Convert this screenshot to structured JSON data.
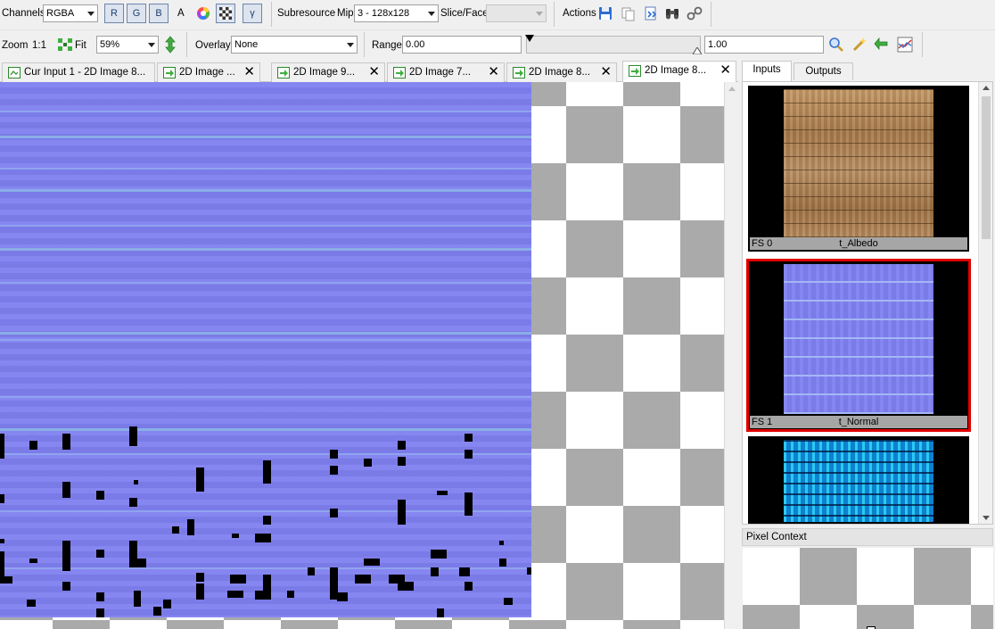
{
  "toolbar1": {
    "channels_label": "Channels",
    "channels_value": "RGBA",
    "r": "R",
    "g": "G",
    "b": "B",
    "a": "A",
    "gamma": "γ",
    "subresource_label": "Subresource",
    "mip_label": "Mip",
    "mip_value": "3 - 128x128",
    "slice_label": "Slice/Face",
    "slice_value": "",
    "actions_label": "Actions"
  },
  "toolbar2": {
    "zoom_label": "Zoom",
    "zoom_1to1": "1:1",
    "fit_label": "Fit",
    "zoom_value": "59%",
    "overlay_label": "Overlay",
    "overlay_value": "None",
    "range_label": "Range",
    "range_min": "0.00",
    "range_max": "1.00"
  },
  "tabs": [
    {
      "label": "Cur Input 1 - 2D Image 8..."
    },
    {
      "label": "2D Image ..."
    },
    {
      "label": "2D Image 9..."
    },
    {
      "label": "2D Image 7..."
    },
    {
      "label": "2D Image 8..."
    },
    {
      "label": "2D Image 8..."
    }
  ],
  "panel": {
    "tab_inputs": "Inputs",
    "tab_outputs": "Outputs",
    "thumbs": [
      {
        "slot": "FS 0",
        "name": "t_Albedo"
      },
      {
        "slot": "FS 1",
        "name": "t_Normal"
      }
    ],
    "pixel_context": "Pixel Context"
  },
  "colors": {
    "selection": "#e10000",
    "normal_map": "#7f7ff0",
    "albedo": "#b08a5e"
  }
}
